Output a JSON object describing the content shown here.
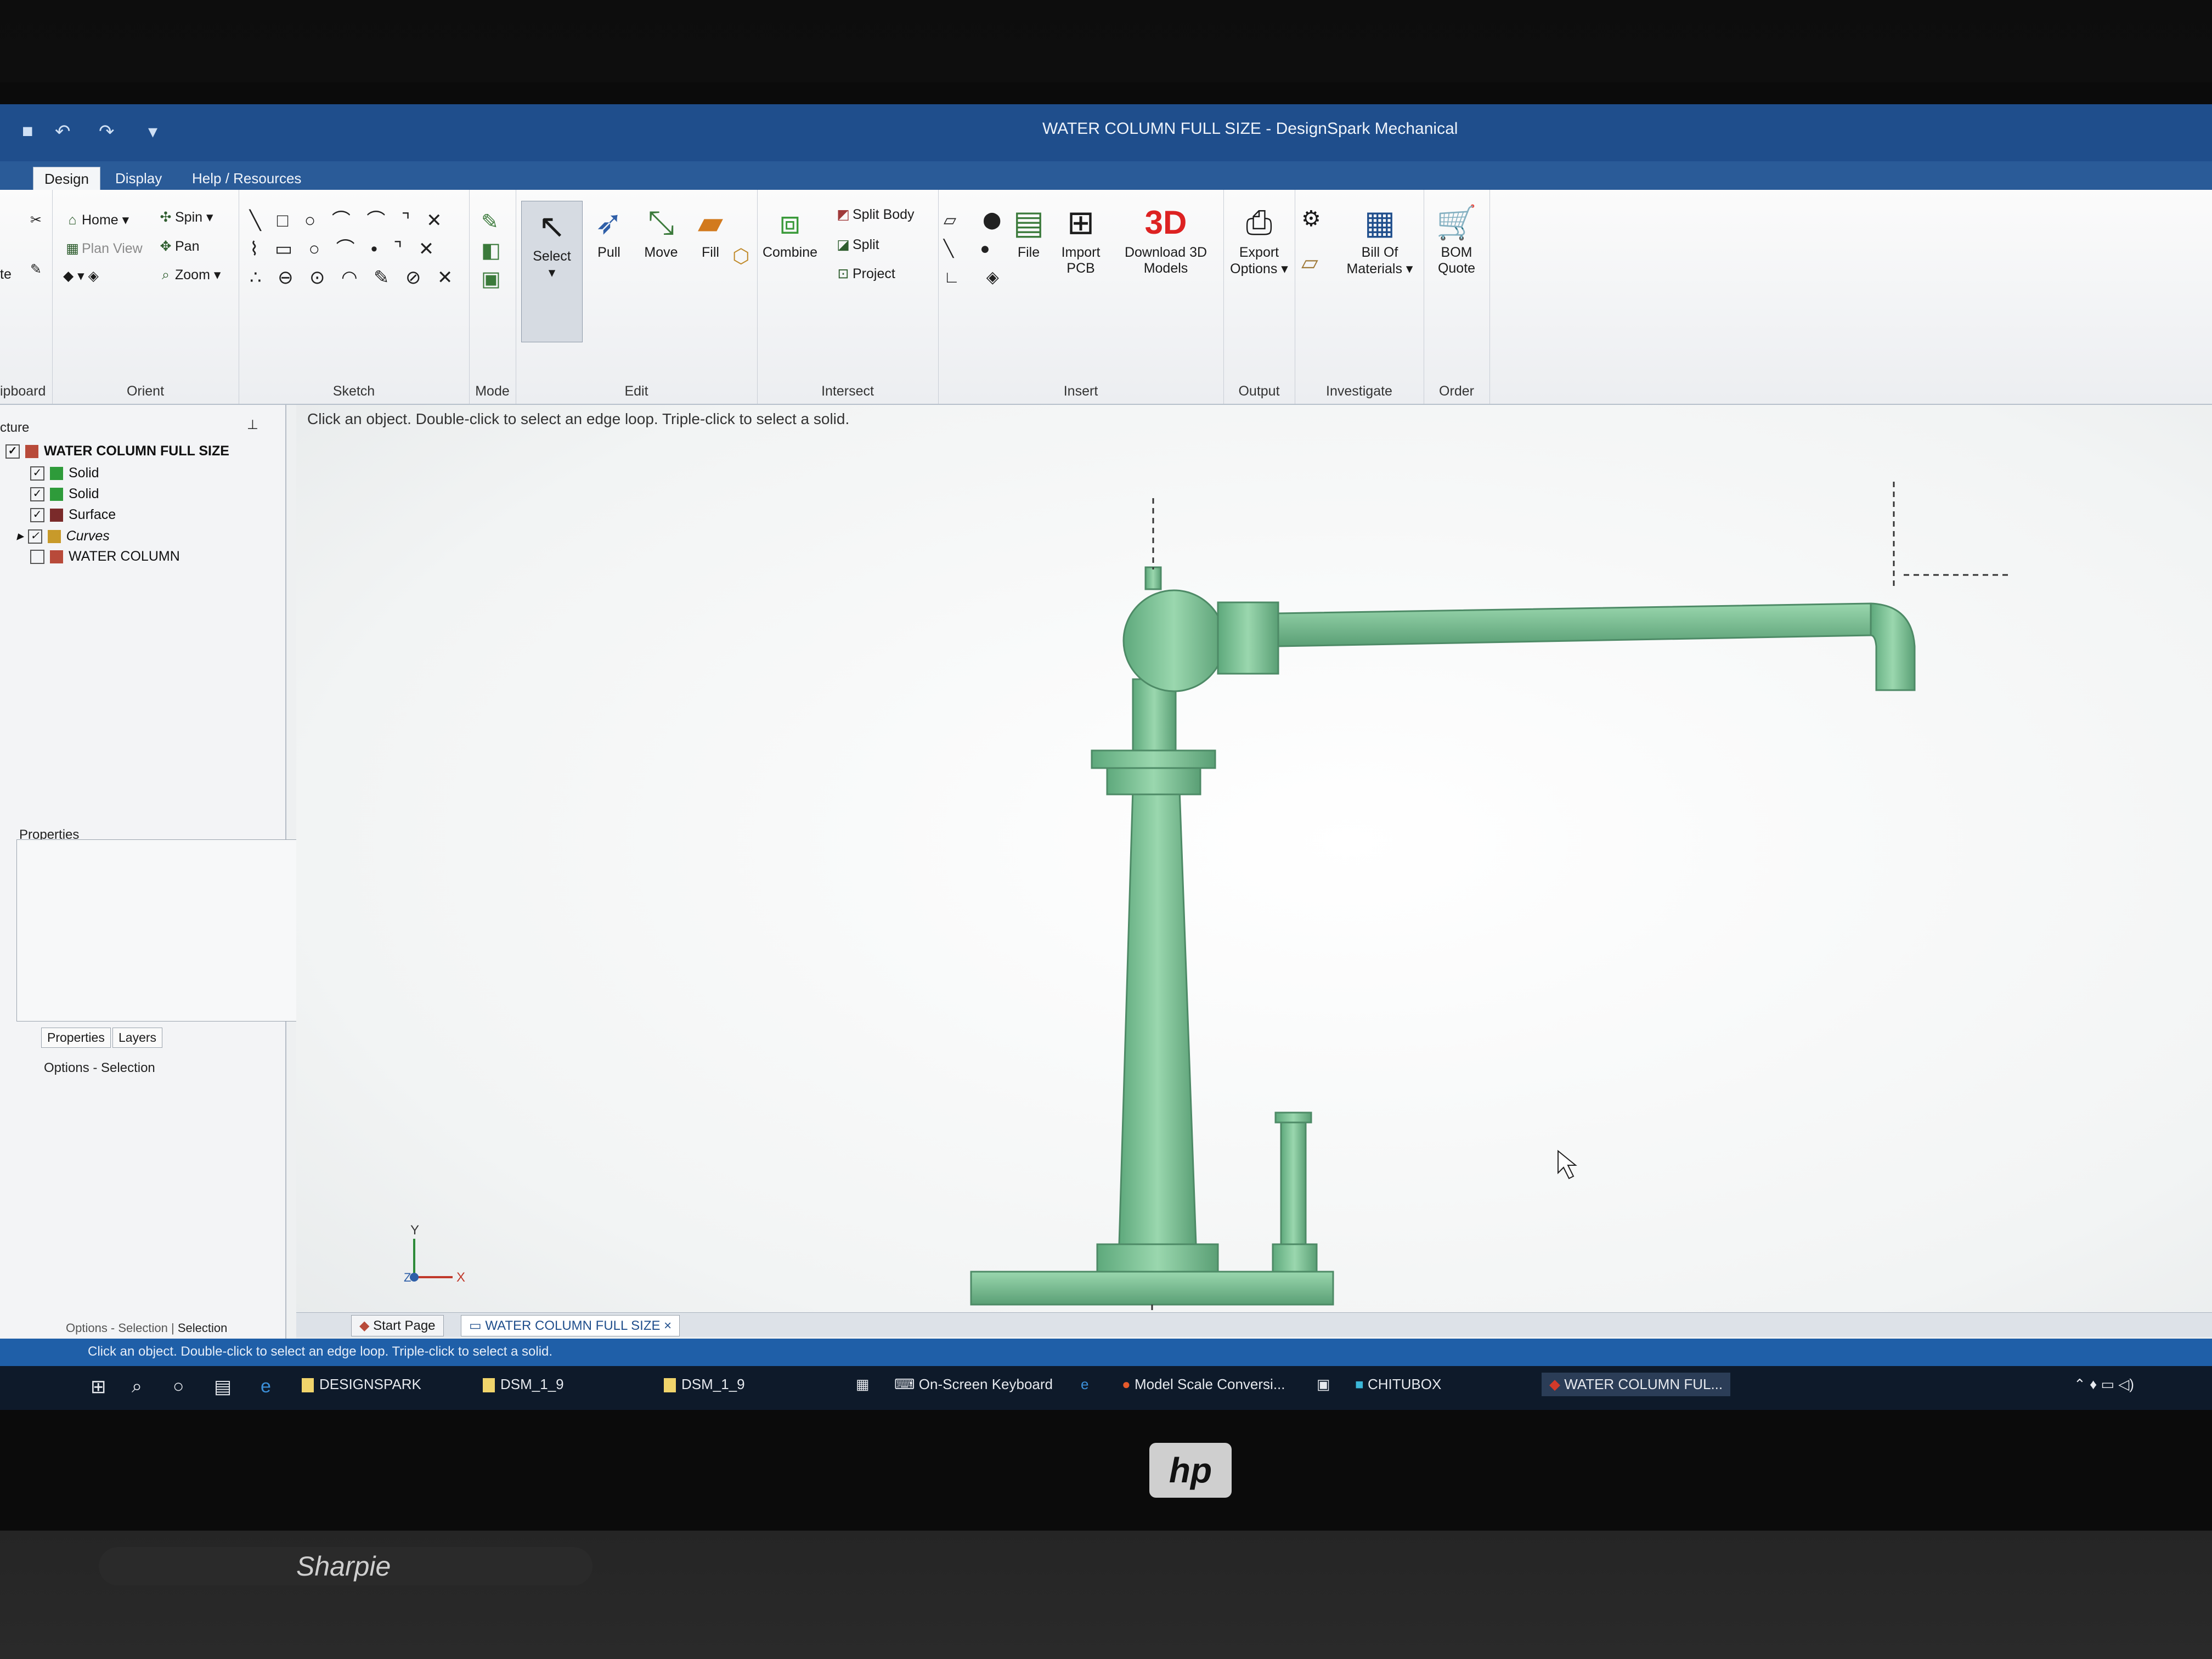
{
  "window": {
    "title": "WATER COLUMN FULL SIZE - DesignSpark Mechanical"
  },
  "tabs": [
    {
      "label": "Design",
      "active": true
    },
    {
      "label": "Display",
      "active": false
    },
    {
      "label": "Help / Resources",
      "active": false
    }
  ],
  "ribbon": {
    "clipboard": {
      "label": "ipboard",
      "paste": "te"
    },
    "orient": {
      "label": "Orient",
      "home": "Home",
      "spin": "Spin",
      "plan_view": "Plan View",
      "pan": "Pan",
      "zoom": "Zoom"
    },
    "sketch": {
      "label": "Sketch"
    },
    "mode": {
      "label": "Mode"
    },
    "edit": {
      "label": "Edit",
      "select": "Select",
      "pull": "Pull",
      "move": "Move",
      "fill": "Fill"
    },
    "intersect": {
      "label": "Intersect",
      "combine": "Combine",
      "split_body": "Split Body",
      "split": "Split",
      "project": "Project"
    },
    "insert": {
      "label": "Insert",
      "file": "File",
      "import_pcb_1": "Import",
      "import_pcb_2": "PCB",
      "download_1": "Download 3D",
      "download_2": "Models",
      "download_icon": "3D"
    },
    "output": {
      "label": "Output",
      "export_1": "Export",
      "export_2": "Options"
    },
    "investigate": {
      "label": "Investigate",
      "bom_1": "Bill Of",
      "bom_2": "Materials"
    },
    "order": {
      "label": "Order",
      "quote_1": "BOM",
      "quote_2": "Quote"
    }
  },
  "structure": {
    "title": "cture",
    "root": "WATER COLUMN FULL SIZE",
    "items": [
      {
        "label": "Solid",
        "checked": true,
        "color": "#2e9b3a"
      },
      {
        "label": "Solid",
        "checked": true,
        "color": "#2e9b3a"
      },
      {
        "label": "Surface",
        "checked": true,
        "color": "#7a2a2a"
      },
      {
        "label": "Curves",
        "checked": true,
        "color": "#c89a2a"
      },
      {
        "label": "WATER COLUMN",
        "checked": false,
        "color": "#b84a3a"
      }
    ]
  },
  "properties": {
    "title": "Properties",
    "tab_properties": "Properties",
    "tab_layers": "Layers",
    "options_title": "Options - Selection"
  },
  "viewport": {
    "hint": "Click an object. Double-click to select an edge loop. Triple-click to select a solid.",
    "model_color": "#7fc49a",
    "axis_y": "Y",
    "axis_x": "X",
    "axis_z": "Z"
  },
  "doc_tabs": {
    "start_page": "Start Page",
    "current": "WATER COLUMN FULL SIZE",
    "close": "×"
  },
  "left_bottom": {
    "options": "Options - Selection",
    "selection": "Selection"
  },
  "status": {
    "text": "Click an object. Double-click to select an edge loop. Triple-click to select a solid."
  },
  "taskbar": {
    "items": [
      {
        "label": "DESIGNSPARK"
      },
      {
        "label": "DSM_1_9"
      },
      {
        "label": "DSM_1_9"
      },
      {
        "label": "On-Screen Keyboard"
      },
      {
        "label": "Model Scale Conversi..."
      },
      {
        "label": "CHITUBOX"
      },
      {
        "label": "WATER COLUMN FUL..."
      }
    ]
  },
  "monitor": {
    "brand": "hp",
    "marker_brand": "Sharpie"
  }
}
